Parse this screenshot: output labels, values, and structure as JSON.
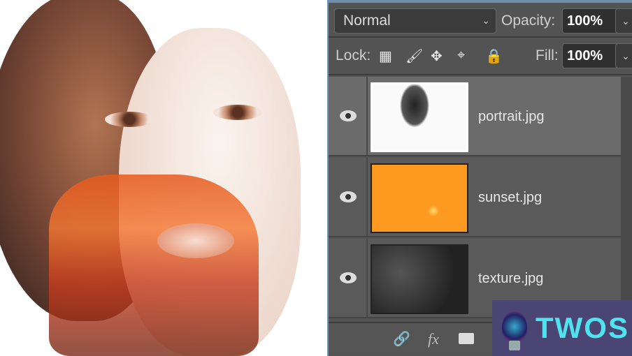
{
  "photo": {
    "description_label": ""
  },
  "panel": {
    "blend_mode": "Normal",
    "opacity_label": "Opacity:",
    "opacity_value": "100%",
    "lock_label": "Lock:",
    "fill_label": "Fill:",
    "fill_value": "100%",
    "layers": [
      {
        "name": "portrait.jpg",
        "selected": true
      },
      {
        "name": "sunset.jpg",
        "selected": false
      },
      {
        "name": "texture.jpg",
        "selected": false
      }
    ],
    "footer_fx": "fx"
  },
  "watermark": {
    "text": "TWOS",
    "color": "#4fe3f0",
    "background": "#4a4572"
  }
}
